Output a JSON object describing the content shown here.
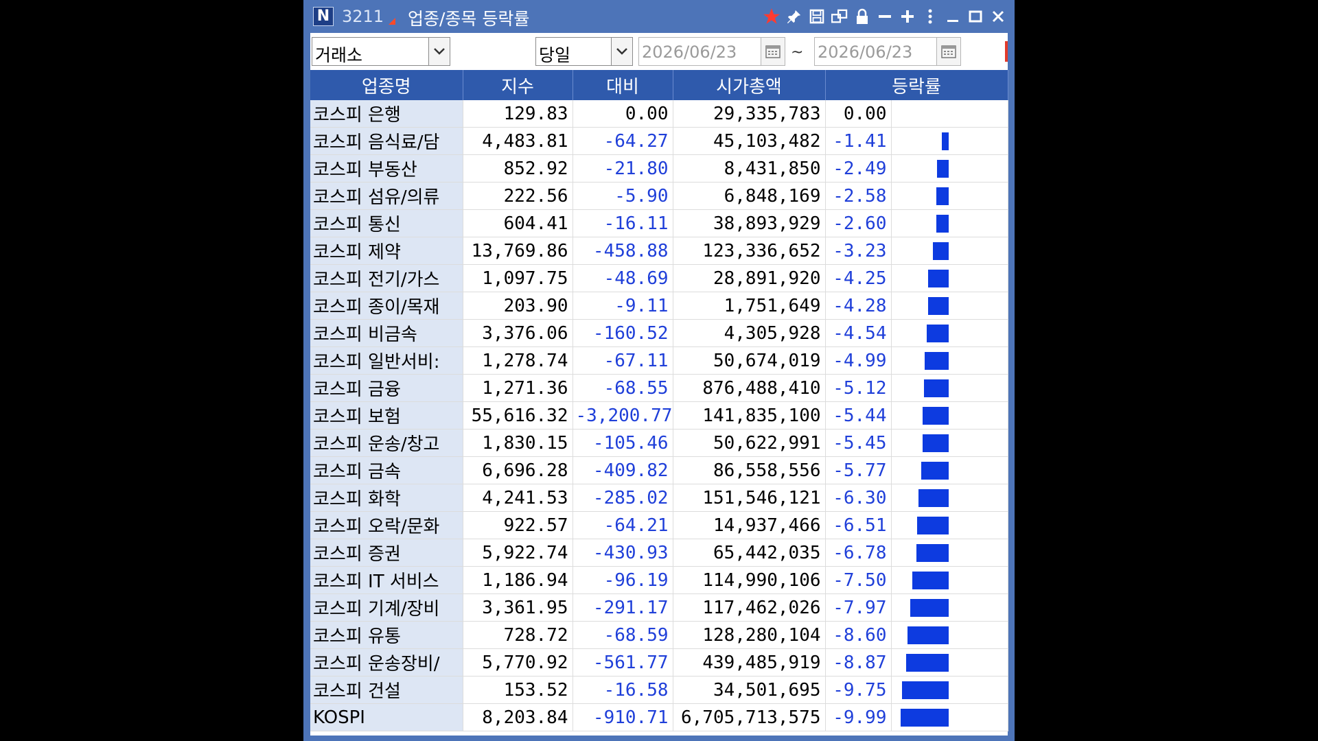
{
  "window": {
    "screen_number": "3211",
    "title": "업종/종목 등락률",
    "logo": "N"
  },
  "titlebar_icons": [
    "star-icon",
    "pin-icon",
    "save-icon",
    "window-link-icon",
    "lock-icon",
    "minus-icon",
    "plus-icon",
    "more-icon",
    "minimize-icon",
    "maximize-icon",
    "close-icon"
  ],
  "colors": {
    "header_bg": "#2f5aac",
    "negative": "#1f3fd9",
    "bar": "#0d3be0",
    "name_bg": "#dde6f4",
    "star": "#ff3b30"
  },
  "filters": {
    "market": "거래소",
    "period": "당일",
    "date_from": "2026/06/23",
    "date_separator": "~",
    "date_to": "2026/06/23"
  },
  "table": {
    "headers": [
      "업종명",
      "지수",
      "대비",
      "시가총액",
      "등락률",
      ""
    ],
    "rows": [
      {
        "name": "코스피 은행",
        "index": "129.83",
        "change": "0.00",
        "mcap": "29,335,783",
        "rate": "0.00",
        "rate_value": 0.0
      },
      {
        "name": "코스피 음식료/담",
        "index": "4,483.81",
        "change": "-64.27",
        "mcap": "45,103,482",
        "rate": "-1.41",
        "rate_value": -1.41
      },
      {
        "name": "코스피 부동산",
        "index": "852.92",
        "change": "-21.80",
        "mcap": "8,431,850",
        "rate": "-2.49",
        "rate_value": -2.49
      },
      {
        "name": "코스피 섬유/의류",
        "index": "222.56",
        "change": "-5.90",
        "mcap": "6,848,169",
        "rate": "-2.58",
        "rate_value": -2.58
      },
      {
        "name": "코스피 통신",
        "index": "604.41",
        "change": "-16.11",
        "mcap": "38,893,929",
        "rate": "-2.60",
        "rate_value": -2.6
      },
      {
        "name": "코스피 제약",
        "index": "13,769.86",
        "change": "-458.88",
        "mcap": "123,336,652",
        "rate": "-3.23",
        "rate_value": -3.23
      },
      {
        "name": "코스피 전기/가스",
        "index": "1,097.75",
        "change": "-48.69",
        "mcap": "28,891,920",
        "rate": "-4.25",
        "rate_value": -4.25
      },
      {
        "name": "코스피 종이/목재",
        "index": "203.90",
        "change": "-9.11",
        "mcap": "1,751,649",
        "rate": "-4.28",
        "rate_value": -4.28
      },
      {
        "name": "코스피 비금속",
        "index": "3,376.06",
        "change": "-160.52",
        "mcap": "4,305,928",
        "rate": "-4.54",
        "rate_value": -4.54
      },
      {
        "name": "코스피 일반서비:",
        "index": "1,278.74",
        "change": "-67.11",
        "mcap": "50,674,019",
        "rate": "-4.99",
        "rate_value": -4.99
      },
      {
        "name": "코스피 금융",
        "index": "1,271.36",
        "change": "-68.55",
        "mcap": "876,488,410",
        "rate": "-5.12",
        "rate_value": -5.12
      },
      {
        "name": "코스피 보험",
        "index": "55,616.32",
        "change": "-3,200.77",
        "mcap": "141,835,100",
        "rate": "-5.44",
        "rate_value": -5.44
      },
      {
        "name": "코스피 운송/창고",
        "index": "1,830.15",
        "change": "-105.46",
        "mcap": "50,622,991",
        "rate": "-5.45",
        "rate_value": -5.45
      },
      {
        "name": "코스피 금속",
        "index": "6,696.28",
        "change": "-409.82",
        "mcap": "86,558,556",
        "rate": "-5.77",
        "rate_value": -5.77
      },
      {
        "name": "코스피 화학",
        "index": "4,241.53",
        "change": "-285.02",
        "mcap": "151,546,121",
        "rate": "-6.30",
        "rate_value": -6.3
      },
      {
        "name": "코스피 오락/문화",
        "index": "922.57",
        "change": "-64.21",
        "mcap": "14,937,466",
        "rate": "-6.51",
        "rate_value": -6.51
      },
      {
        "name": "코스피 증권",
        "index": "5,922.74",
        "change": "-430.93",
        "mcap": "65,442,035",
        "rate": "-6.78",
        "rate_value": -6.78
      },
      {
        "name": "코스피 IT 서비스",
        "index": "1,186.94",
        "change": "-96.19",
        "mcap": "114,990,106",
        "rate": "-7.50",
        "rate_value": -7.5
      },
      {
        "name": "코스피 기계/장비",
        "index": "3,361.95",
        "change": "-291.17",
        "mcap": "117,462,026",
        "rate": "-7.97",
        "rate_value": -7.97
      },
      {
        "name": "코스피 유통",
        "index": "728.72",
        "change": "-68.59",
        "mcap": "128,280,104",
        "rate": "-8.60",
        "rate_value": -8.6
      },
      {
        "name": "코스피 운송장비/",
        "index": "5,770.92",
        "change": "-561.77",
        "mcap": "439,485,919",
        "rate": "-8.87",
        "rate_value": -8.87
      },
      {
        "name": "코스피 건설",
        "index": "153.52",
        "change": "-16.58",
        "mcap": "34,501,695",
        "rate": "-9.75",
        "rate_value": -9.75
      },
      {
        "name": "KOSPI",
        "index": "8,203.84",
        "change": "-910.71",
        "mcap": "6,705,713,575",
        "rate": "-9.99",
        "rate_value": -9.99
      }
    ]
  }
}
